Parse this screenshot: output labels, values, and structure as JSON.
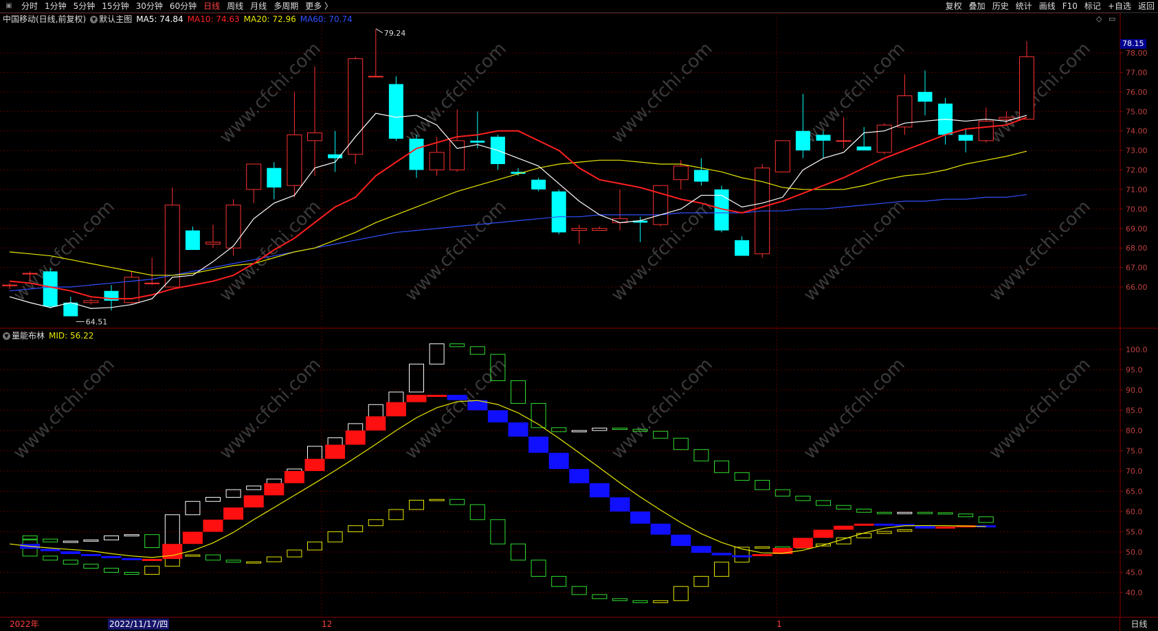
{
  "toolbar": {
    "left": [
      "分时",
      "1分钟",
      "5分钟",
      "15分钟",
      "30分钟",
      "60分钟",
      "日线",
      "周线",
      "月线",
      "多周期",
      "更多 〉"
    ],
    "active": "日线",
    "right": [
      "复权",
      "叠加",
      "历史",
      "统计",
      "画线",
      "F10",
      "标记",
      "+自选",
      "返回"
    ]
  },
  "legend": {
    "stock": "中国移动(日线,前复权)",
    "main": "默认主图",
    "ma5": "MA5: 74.84",
    "ma10": "MA10: 74.63",
    "ma20": "MA20: 72.96",
    "ma60": "MA60: 70.74",
    "colors": {
      "ma5": "#ffffff",
      "ma10": "#ff2020",
      "ma20": "#e8e800",
      "ma60": "#3050ff"
    }
  },
  "indicator": {
    "name": "量能布林",
    "mid": "MID: 56.22"
  },
  "current_price_tag": "78.15",
  "price_axis": [
    "78.00",
    "77.00",
    "76.00",
    "75.00",
    "74.00",
    "73.00",
    "72.00",
    "71.00",
    "70.00",
    "69.00",
    "68.00",
    "67.00",
    "66.00"
  ],
  "indicator_axis": [
    "100.0",
    "95.0",
    "90.0",
    "85.0",
    "80.0",
    "75.0",
    "70.0",
    "65.0",
    "60.0",
    "55.0",
    "50.0",
    "45.0",
    "40.0"
  ],
  "annotations": {
    "high": "79.24",
    "low": "64.51"
  },
  "date_axis": {
    "year": "2022年",
    "cursor_date": "2022/11/17/四",
    "month12": "12",
    "month1": "1"
  },
  "status_right": "日线",
  "watermark": "www.cfchi.com",
  "candles": [
    [
      66.1,
      66.2,
      65.9,
      66.1
    ],
    [
      66.7,
      66.8,
      66.3,
      66.7
    ],
    [
      66.8,
      67.0,
      64.9,
      65.0
    ],
    [
      65.2,
      65.5,
      64.5,
      64.5
    ],
    [
      65.2,
      65.4,
      65.1,
      65.3
    ],
    [
      65.8,
      66.1,
      64.8,
      65.3
    ],
    [
      65.2,
      66.8,
      65.1,
      66.5
    ],
    [
      66.2,
      67.5,
      66.1,
      66.2
    ],
    [
      66.0,
      71.1,
      66.0,
      70.2
    ],
    [
      68.9,
      69.1,
      68.3,
      67.9
    ],
    [
      68.2,
      69.2,
      68.0,
      68.3
    ],
    [
      68.0,
      70.5,
      67.6,
      70.2
    ],
    [
      71.0,
      72.2,
      70.3,
      72.3
    ],
    [
      72.1,
      72.4,
      70.5,
      71.1
    ],
    [
      71.2,
      76.0,
      70.6,
      73.8
    ],
    [
      73.5,
      77.3,
      71.7,
      73.9
    ],
    [
      72.8,
      74.0,
      71.9,
      72.6
    ],
    [
      72.8,
      77.8,
      72.3,
      77.7
    ],
    [
      76.8,
      79.2,
      76.8,
      76.8
    ],
    [
      76.4,
      76.8,
      73.5,
      73.6
    ],
    [
      73.6,
      73.8,
      71.6,
      72.0
    ],
    [
      72.0,
      73.7,
      71.7,
      72.9
    ],
    [
      72.0,
      75.1,
      71.9,
      73.5
    ],
    [
      73.5,
      75.0,
      73.1,
      73.4
    ],
    [
      73.7,
      73.8,
      72.0,
      72.3
    ],
    [
      71.9,
      72.1,
      71.7,
      71.8
    ],
    [
      71.5,
      71.6,
      70.9,
      71.0
    ],
    [
      70.9,
      71.0,
      68.7,
      68.8
    ],
    [
      68.9,
      69.2,
      68.2,
      69.0
    ],
    [
      68.9,
      69.1,
      68.9,
      69.0
    ],
    [
      69.3,
      71.0,
      68.9,
      69.5
    ],
    [
      69.4,
      69.6,
      68.3,
      69.3
    ],
    [
      69.2,
      71.2,
      69.1,
      71.2
    ],
    [
      71.5,
      72.5,
      71.0,
      72.2
    ],
    [
      72.0,
      72.6,
      71.2,
      71.4
    ],
    [
      71.0,
      71.2,
      68.8,
      68.9
    ],
    [
      68.4,
      68.6,
      67.6,
      67.6
    ],
    [
      67.7,
      72.3,
      67.5,
      72.1
    ],
    [
      71.9,
      73.4,
      71.9,
      73.5
    ],
    [
      74.0,
      75.9,
      72.6,
      73.0
    ],
    [
      73.8,
      74.0,
      72.6,
      73.5
    ],
    [
      73.5,
      74.7,
      73.1,
      73.5
    ],
    [
      73.2,
      74.2,
      73.0,
      73.0
    ],
    [
      72.9,
      74.4,
      72.8,
      74.3
    ],
    [
      74.2,
      76.9,
      73.8,
      75.8
    ],
    [
      76.0,
      77.1,
      74.8,
      75.5
    ],
    [
      75.4,
      75.7,
      73.3,
      73.8
    ],
    [
      73.8,
      74.1,
      72.9,
      73.5
    ],
    [
      73.5,
      75.2,
      73.4,
      74.5
    ],
    [
      74.6,
      75.0,
      74.4,
      74.7
    ],
    [
      74.6,
      78.6,
      74.6,
      77.8
    ]
  ],
  "ma5": [
    65.5,
    65.2,
    64.95,
    65.2,
    64.9,
    64.95,
    65.1,
    65.4,
    66.5,
    66.6,
    67.3,
    68.1,
    69.5,
    70.3,
    70.7,
    72.1,
    72.4,
    73.7,
    74.9,
    74.7,
    74.8,
    74.3,
    73.1,
    73.3,
    73.0,
    72.6,
    72.2,
    71.3,
    70.4,
    69.7,
    69.3,
    69.4,
    69.7,
    70.0,
    70.7,
    70.7,
    70.1,
    70.3,
    70.6,
    72.0,
    72.6,
    72.9,
    73.9,
    74.0,
    74.4,
    74.5,
    74.6,
    74.5,
    74.6,
    74.5,
    74.8
  ],
  "ma10": [
    66.3,
    66.2,
    66.0,
    65.8,
    65.5,
    65.4,
    65.4,
    65.6,
    65.9,
    66.1,
    66.3,
    66.6,
    67.2,
    67.9,
    68.5,
    69.3,
    70.1,
    70.6,
    71.7,
    72.4,
    73.1,
    73.4,
    73.7,
    73.8,
    74.0,
    74.0,
    73.5,
    73.0,
    72.1,
    71.5,
    71.3,
    71.1,
    70.8,
    70.5,
    70.3,
    70.0,
    69.8,
    70.1,
    70.4,
    70.8,
    71.2,
    71.6,
    72.1,
    72.6,
    73.0,
    73.4,
    73.8,
    74.1,
    74.2,
    74.3,
    74.7
  ],
  "ma20": [
    67.8,
    67.7,
    67.6,
    67.4,
    67.2,
    67.0,
    66.8,
    66.6,
    66.6,
    66.7,
    66.9,
    67.1,
    67.2,
    67.5,
    67.8,
    68.0,
    68.4,
    68.8,
    69.3,
    69.7,
    70.1,
    70.5,
    70.9,
    71.2,
    71.5,
    71.8,
    72.1,
    72.3,
    72.4,
    72.5,
    72.5,
    72.4,
    72.3,
    72.3,
    72.1,
    71.9,
    71.6,
    71.4,
    71.1,
    71.0,
    71.0,
    71.0,
    71.2,
    71.5,
    71.7,
    71.8,
    72.0,
    72.3,
    72.5,
    72.7,
    72.96
  ],
  "ma60": [
    65.8,
    65.9,
    66.0,
    66.0,
    66.1,
    66.2,
    66.3,
    66.4,
    66.6,
    66.8,
    67.0,
    67.2,
    67.4,
    67.6,
    67.8,
    68.0,
    68.2,
    68.4,
    68.6,
    68.8,
    68.9,
    69.0,
    69.1,
    69.2,
    69.3,
    69.4,
    69.5,
    69.6,
    69.6,
    69.7,
    69.7,
    69.7,
    69.7,
    69.8,
    69.8,
    69.8,
    69.8,
    69.9,
    69.9,
    70.0,
    70.0,
    70.1,
    70.2,
    70.3,
    70.4,
    70.4,
    70.5,
    70.5,
    70.6,
    70.6,
    70.74
  ],
  "ind_upper": [
    54,
    53.2,
    52.5,
    52.7,
    53,
    54,
    54.3,
    51.1,
    59.2,
    62.5,
    63.5,
    65.4,
    66.3,
    68,
    70.5,
    76.1,
    78.2,
    81.7,
    86.4,
    89.5,
    96.4,
    101.4,
    100.7,
    98.8,
    92.3,
    86.7,
    80.7,
    79.7,
    80,
    80.6,
    80.3,
    79.8,
    78.1,
    75.3,
    72.5,
    69.6,
    67.7,
    65.4,
    63.8,
    62.7,
    61.5,
    60.6,
    59.8,
    59.7,
    59.8,
    59.7,
    59.4,
    58.7,
    57.3
  ],
  "ind_mid": [
    52,
    50.8,
    50.2,
    49.5,
    49,
    48.5,
    48,
    48.3,
    52,
    55,
    58,
    61,
    64,
    67,
    70,
    73,
    76.5,
    80,
    83.5,
    87,
    88.8,
    88.8,
    87.5,
    85,
    82,
    78.5,
    74.5,
    70.5,
    67,
    63.5,
    60,
    57,
    54.3,
    51.5,
    49.8,
    49.2,
    49,
    49.5,
    51,
    53.5,
    55.5,
    56.5,
    57,
    56.9,
    56.5,
    55.8,
    56.3,
    56.6,
    56.2
  ],
  "ind_lower": [
    53,
    49,
    48,
    47,
    46,
    45,
    44.5,
    46.5,
    49.3,
    49.3,
    48,
    47.5,
    47.6,
    48.8,
    50.5,
    52.5,
    55,
    56.5,
    58,
    60.5,
    62.8,
    63,
    61.7,
    58,
    52,
    48,
    44,
    41.5,
    39.5,
    38.5,
    38,
    37.5,
    38,
    41.5,
    44,
    47.5,
    51.2,
    51.3,
    51,
    51.5,
    52,
    53.5,
    54.6,
    55.1,
    55.5
  ]
}
